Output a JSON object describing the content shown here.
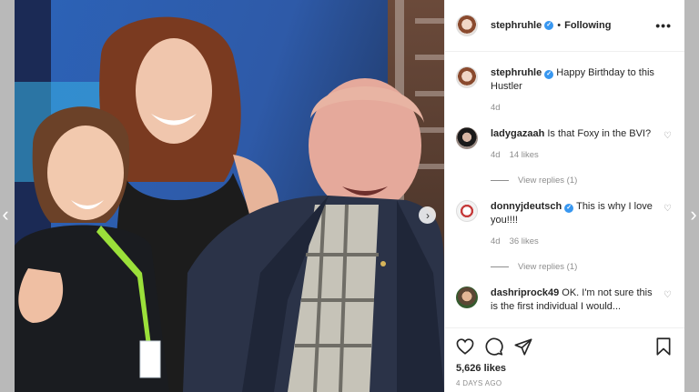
{
  "post": {
    "username": "stephruhle",
    "follow_state": "Following",
    "separator": "•",
    "more": "•••",
    "likes": "5,626 likes",
    "posted": "4 DAYS AGO"
  },
  "caption": {
    "username": "stephruhle",
    "text": "Happy Birthday to this Hustler",
    "age": "4d"
  },
  "comments": [
    {
      "username": "ladygazaah",
      "verified": false,
      "text": "Is that Foxy in the BVI?",
      "age": "4d",
      "likes": "14 likes",
      "view_replies": "View replies (1)"
    },
    {
      "username": "donnyjdeutsch",
      "verified": true,
      "text": "This is why I love you!!!!",
      "age": "4d",
      "likes": "36 likes",
      "view_replies": "View replies (1)"
    },
    {
      "username": "dashriprock49",
      "verified": false,
      "text": "OK. I'm not sure this is the first individual I would..."
    }
  ],
  "icons": {
    "verified": "check-badge-icon",
    "heart": "heart-icon",
    "comment": "comment-icon",
    "share": "share-icon",
    "bookmark": "bookmark-icon",
    "next": "chevron-right-icon",
    "page_prev": "chevron-left-icon",
    "page_next": "chevron-right-icon"
  },
  "colors": {
    "verified": "#3897f0",
    "text": "#262626",
    "muted": "#8e8e8e",
    "backdrop": "#b9b9b9"
  }
}
